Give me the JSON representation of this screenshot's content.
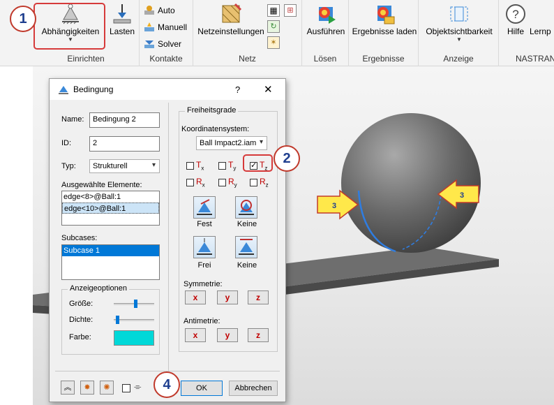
{
  "ribbon": {
    "einrichten": {
      "group_label": "Einrichten",
      "abhaengigkeiten": "Abhängigkeiten",
      "lasten": "Lasten"
    },
    "kontakte": {
      "group_label": "Kontakte",
      "auto": "Auto",
      "manuell": "Manuell",
      "solver": "Solver"
    },
    "netz": {
      "group_label": "Netz",
      "netzeinstellungen": "Netzeinstellungen"
    },
    "loesen": {
      "group_label": "Lösen",
      "ausfuehren": "Ausführen"
    },
    "ergebnisse": {
      "group_label": "Ergebnisse",
      "ergebnisse_laden": "Ergebnisse laden"
    },
    "anzeige": {
      "group_label": "Anzeige",
      "objektsichtbarkeit": "Objektsichtbarkeit"
    },
    "nastran": {
      "group_label": "NASTRAN",
      "hilfe": "Hilfe",
      "lernpfad": "Lernp"
    }
  },
  "dialog": {
    "title": "Bedingung",
    "help": "?",
    "close": "✕",
    "name_label": "Name:",
    "name_value": "Bedingung 2",
    "id_label": "ID:",
    "id_value": "2",
    "typ_label": "Typ:",
    "typ_value": "Strukturell",
    "ausgewaehlte_label": "Ausgewählte Elemente:",
    "elements": [
      "edge<8>@Ball:1",
      "edge<10>@Ball:1"
    ],
    "subcases_label": "Subcases:",
    "subcases": [
      "Subcase 1"
    ],
    "anzeigeoptionen": {
      "title": "Anzeigeoptionen",
      "groesse": "Größe:",
      "dichte": "Dichte:",
      "farbe": "Farbe:",
      "farbe_color": "#00d8d8",
      "groesse_level": 0.55,
      "dichte_level": 0.05
    },
    "freiheitsgrade": {
      "title": "Freiheitsgrade",
      "koordinatensystem_label": "Koordinatensystem:",
      "koordinatensystem_value": "Ball Impact2.iam",
      "tx": {
        "letter": "T",
        "sub": "x",
        "checked": false
      },
      "ty": {
        "letter": "T",
        "sub": "y",
        "checked": false
      },
      "tz": {
        "letter": "T",
        "sub": "z",
        "checked": true
      },
      "rx": {
        "letter": "R",
        "sub": "x",
        "checked": false
      },
      "ry": {
        "letter": "R",
        "sub": "y",
        "checked": false
      },
      "rz": {
        "letter": "R",
        "sub": "z",
        "checked": false
      },
      "fest": "Fest",
      "keine1": "Keine",
      "frei": "Frei",
      "keine2": "Keine",
      "symmetrie_label": "Symmetrie:",
      "antimetrie_label": "Antimetrie:",
      "x": "x",
      "y": "y",
      "z": "z"
    },
    "ok": "OK",
    "abbrechen": "Abbrechen"
  },
  "callouts": {
    "c1": "1",
    "c2": "2",
    "c3a": "3",
    "c3b": "3",
    "c4": "4"
  },
  "colors": {
    "accent": "#0078d7",
    "callout_border": "#c0392b",
    "arrow_fill": "#ffe84a"
  }
}
